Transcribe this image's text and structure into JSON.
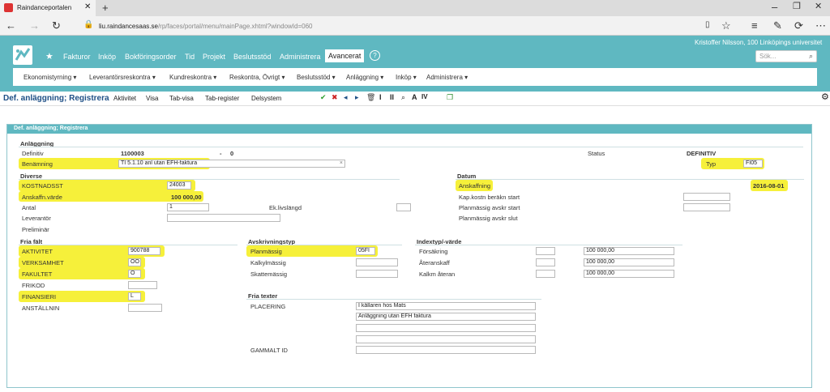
{
  "browser": {
    "tab_title": "Raindanceportalen",
    "url_host": "liu.raindancesaas.se",
    "url_path": "/rp/faces/portal/menu/mainPage.xhtml?windowId=060"
  },
  "header": {
    "user": "Kristoffer Nilsson, 100 Linköpings universitet",
    "search_placeholder": "Sök...",
    "nav": [
      "Fakturor",
      "Inköp",
      "Bokföringsorder",
      "Tid",
      "Projekt",
      "Beslutsstöd",
      "Administrera",
      "Avancerat"
    ],
    "subnav": [
      "Ekonomistyrning",
      "Leverantörsreskontra",
      "Kundreskontra",
      "Reskontra, Övrigt",
      "Beslutsstöd",
      "Anläggning",
      "Inköp",
      "Administrera"
    ]
  },
  "toolbar": {
    "title": "Def. anläggning; Registrera",
    "links": [
      "Aktivitet",
      "Visa",
      "Tab-visa",
      "Tab-register",
      "Delsystem"
    ],
    "icons": [
      "check-icon",
      "cancel-icon",
      "arrow-left-icon",
      "arrow-right-icon",
      "trash-icon",
      "info-icon",
      "pause-icon",
      "search-icon",
      "lv-icon",
      "copy-icon",
      "gear-icon"
    ]
  },
  "panel": {
    "title": "Def. anläggning; Registrera",
    "anlaggning": {
      "heading": "Anläggning",
      "definitiv_label": "Definitiv",
      "definitiv_value": "1100003",
      "dash": "-",
      "definitiv_suffix": "0",
      "status_label": "Status",
      "status_value": "DEFINITIV",
      "benamning_label": "Benämning",
      "benamning_value": "TI 5.1.10 anl utan EFH-faktura",
      "typ_label": "Typ",
      "typ_value": "FI05"
    },
    "diverse": {
      "heading": "Diverse",
      "kostnadsst_label": "KOSTNADSST",
      "kostnadsst_value": "24003",
      "anskaffn_label": "Anskaffn.värde",
      "anskaffn_value": "100 000,00",
      "antal_label": "Antal",
      "antal_value": "1",
      "eklivslangd_label": "Ek.livslängd",
      "leverantor_label": "Leverantör",
      "preliminar_label": "Preliminär"
    },
    "datum": {
      "heading": "Datum",
      "anskaffning_label": "Anskaffning",
      "anskaffning_value": "2016-08-01",
      "kapkostn_label": "Kap.kostn beräkn start",
      "planmassig_start_label": "Planmässig avskr start",
      "planmassig_slut_label": "Planmässig avskr slut"
    },
    "fria_falt": {
      "heading": "Fria fält",
      "rows": [
        {
          "label": "AKTIVITET",
          "value": "900788"
        },
        {
          "label": "VERKSAMHET",
          "value": "OO"
        },
        {
          "label": "FAKULTET",
          "value": "O"
        },
        {
          "label": "FRIKOD",
          "value": ""
        },
        {
          "label": "FINANSIERI",
          "value": "L"
        },
        {
          "label": "ANSTÄLLNIN",
          "value": ""
        }
      ]
    },
    "avskrivning": {
      "heading": "Avskrivningstyp",
      "rows": [
        {
          "label": "Planmässig",
          "value": "05FI"
        },
        {
          "label": "Kalkylmässig",
          "value": ""
        },
        {
          "label": "Skattemässig",
          "value": ""
        }
      ]
    },
    "indextyp": {
      "heading": "Indextyp/-värde",
      "rows": [
        {
          "label": "Försäkring",
          "value": "100 000,00"
        },
        {
          "label": "Återanskaff",
          "value": "100 000,00"
        },
        {
          "label": "Kalkm återan",
          "value": "100 000,00"
        }
      ]
    },
    "fria_texter": {
      "heading": "Fria texter",
      "placering_label": "PLACERING",
      "lines": [
        "I källaren hos Mats",
        "Anläggning utan EFH faktura",
        "",
        ""
      ],
      "gammalt_label": "GAMMALT ID",
      "gammalt_value": ""
    }
  }
}
